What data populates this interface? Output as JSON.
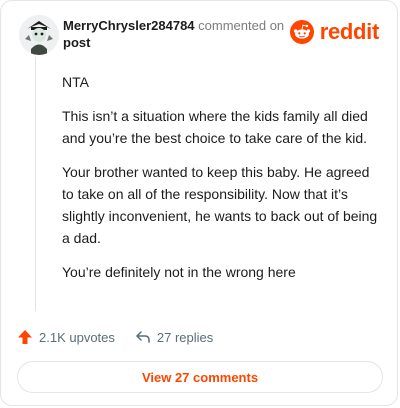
{
  "comment": {
    "username": "MerryChrysler284784",
    "action_text": "commented on",
    "target_text": "post",
    "paragraphs": [
      "NTA",
      "This isn’t a situation where the kids family all died and you’re the best choice to take care of the kid.",
      "Your brother wanted to keep this baby. He agreed to take on all of the responsibility. Now that it’s slightly inconvenient, he wants to back out of being a dad.",
      "You’re definitely not in the wrong here"
    ]
  },
  "brand": {
    "name": "reddit",
    "icon": "reddit-snoo-icon",
    "color": "#ff4500"
  },
  "actions": {
    "upvotes_label": "2.1K upvotes",
    "upvote_icon": "upvote-arrow-icon",
    "replies_label": "27 replies",
    "reply_icon": "reply-arrow-icon"
  },
  "view_button": {
    "label": "View 27 comments"
  }
}
